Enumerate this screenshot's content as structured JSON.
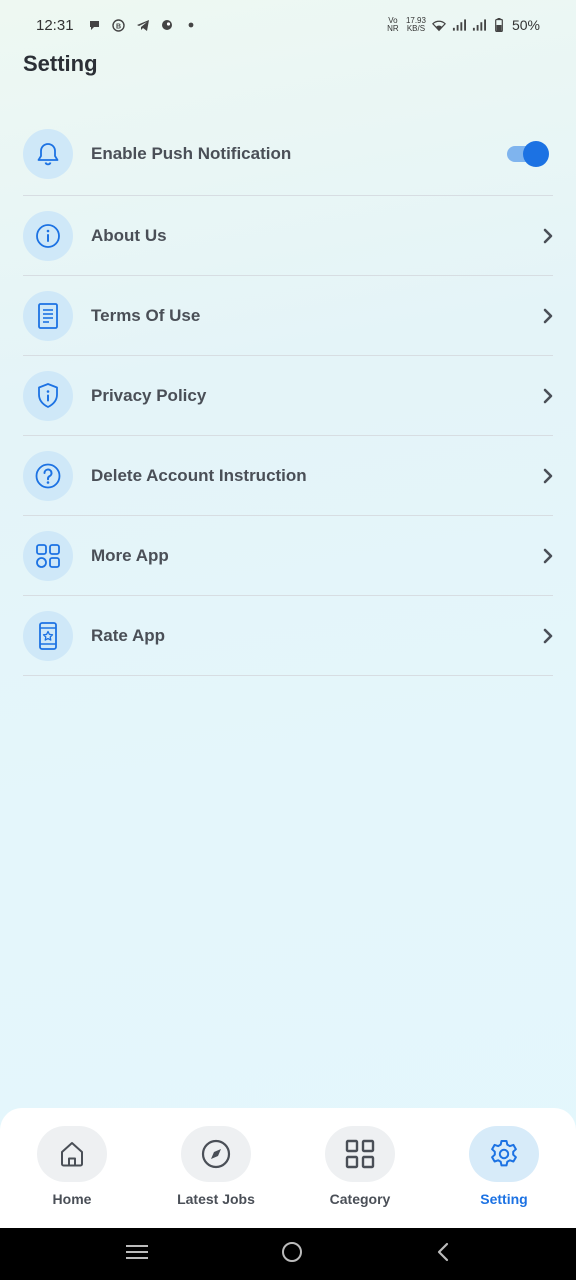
{
  "status_bar": {
    "time": "12:31",
    "network_type": "Vo NR",
    "speed_value": "17.93",
    "speed_unit": "KB/S",
    "battery": "50%"
  },
  "page": {
    "title": "Setting"
  },
  "settings": [
    {
      "key": "push",
      "label": "Enable Push Notification",
      "icon": "bell-icon",
      "control": "toggle",
      "enabled": true
    },
    {
      "key": "about",
      "label": "About Us",
      "icon": "info-icon",
      "control": "chevron"
    },
    {
      "key": "terms",
      "label": "Terms Of Use",
      "icon": "document-icon",
      "control": "chevron"
    },
    {
      "key": "privacy",
      "label": "Privacy Policy",
      "icon": "shield-icon",
      "control": "chevron"
    },
    {
      "key": "delete",
      "label": "Delete Account Instruction",
      "icon": "question-icon",
      "control": "chevron"
    },
    {
      "key": "more",
      "label": "More App",
      "icon": "grid-icon",
      "control": "chevron"
    },
    {
      "key": "rate",
      "label": "Rate App",
      "icon": "phone-star-icon",
      "control": "chevron"
    }
  ],
  "bottom_nav": [
    {
      "label": "Home",
      "icon": "home-icon",
      "active": false
    },
    {
      "label": "Latest Jobs",
      "icon": "compass-icon",
      "active": false
    },
    {
      "label": "Category",
      "icon": "category-grid-icon",
      "active": false
    },
    {
      "label": "Setting",
      "icon": "gear-icon",
      "active": true
    }
  ],
  "colors": {
    "accent": "#1c72e3",
    "icon_bg": "#cfe8f8",
    "label": "#4a4f57",
    "divider": "#d7dde2"
  }
}
